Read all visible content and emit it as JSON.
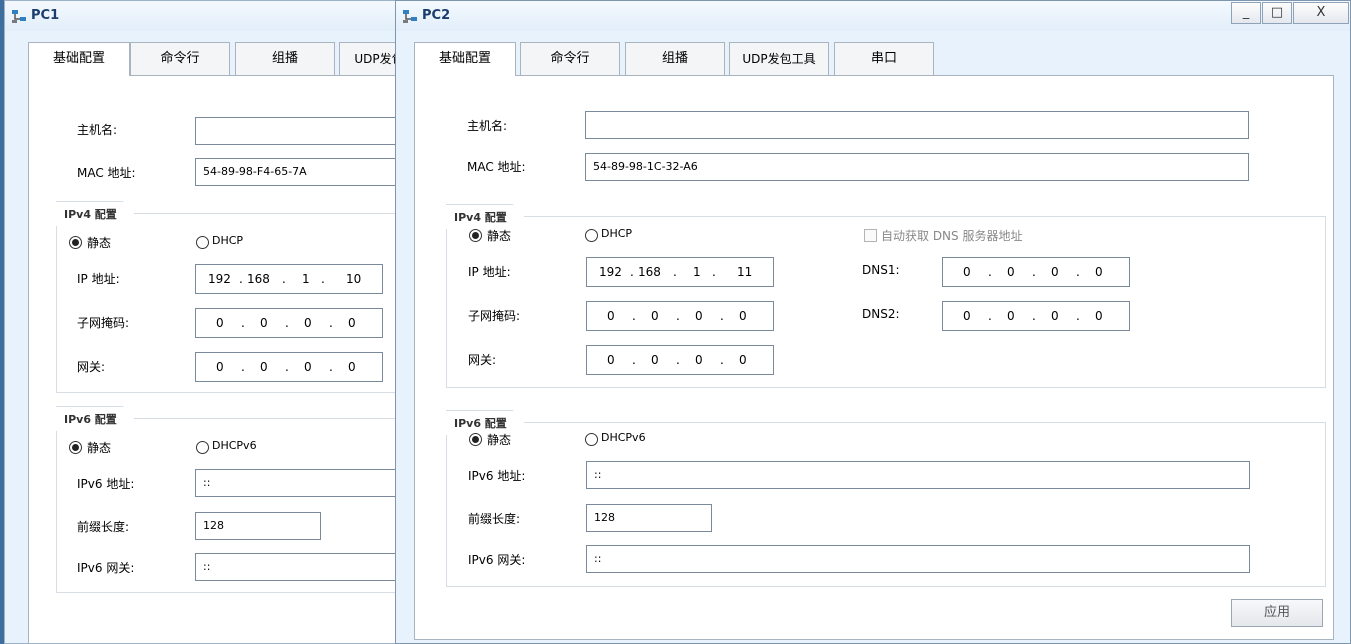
{
  "pc1": {
    "title": "PC1",
    "tabs": [
      "基础配置",
      "命令行",
      "组播",
      "UDP发包"
    ],
    "hostname_label": "主机名:",
    "hostname_value": "",
    "mac_label": "MAC 地址:",
    "mac_value": "54-89-98-F4-65-7A",
    "ipv4": {
      "title": "IPv4 配置",
      "static_label": "静态",
      "dhcp_label": "DHCP",
      "ip_label": "IP 地址:",
      "ip": [
        "192",
        "168",
        "1",
        "10"
      ],
      "mask_label": "子网掩码:",
      "mask": [
        "0",
        "0",
        "0",
        "0"
      ],
      "gateway_label": "网关:",
      "gateway": [
        "0",
        "0",
        "0",
        "0"
      ]
    },
    "ipv6": {
      "title": "IPv6 配置",
      "static_label": "静态",
      "dhcp_label": "DHCPv6",
      "addr_label": "IPv6 地址:",
      "addr": "::",
      "prefix_label": "前缀长度:",
      "prefix": "128",
      "gateway_label": "IPv6 网关:",
      "gateway": "::"
    }
  },
  "pc2": {
    "title": "PC2",
    "window_buttons": {
      "minimize": "_",
      "maximize": "□",
      "close": "X"
    },
    "tabs": [
      "基础配置",
      "命令行",
      "组播",
      "UDP发包工具",
      "串口"
    ],
    "hostname_label": "主机名:",
    "hostname_value": "",
    "mac_label": "MAC 地址:",
    "mac_value": "54-89-98-1C-32-A6",
    "ipv4": {
      "title": "IPv4 配置",
      "static_label": "静态",
      "dhcp_label": "DHCP",
      "auto_dns_label": "自动获取 DNS 服务器地址",
      "ip_label": "IP 地址:",
      "ip": [
        "192",
        "168",
        "1",
        "11"
      ],
      "mask_label": "子网掩码:",
      "mask": [
        "0",
        "0",
        "0",
        "0"
      ],
      "gateway_label": "网关:",
      "gateway": [
        "0",
        "0",
        "0",
        "0"
      ],
      "dns1_label": "DNS1:",
      "dns1": [
        "0",
        "0",
        "0",
        "0"
      ],
      "dns2_label": "DNS2:",
      "dns2": [
        "0",
        "0",
        "0",
        "0"
      ]
    },
    "ipv6": {
      "title": "IPv6 配置",
      "static_label": "静态",
      "dhcp_label": "DHCPv6",
      "addr_label": "IPv6 地址:",
      "addr": "::",
      "prefix_label": "前缀长度:",
      "prefix": "128",
      "gateway_label": "IPv6 网关:",
      "gateway": "::"
    },
    "apply_label": "应用"
  },
  "colors": {
    "window_bg": "#e8f2fc",
    "panel_bg": "#ffffff",
    "title_text": "#1b3d6e"
  },
  "icons": {
    "title": "pc-network-icon"
  }
}
